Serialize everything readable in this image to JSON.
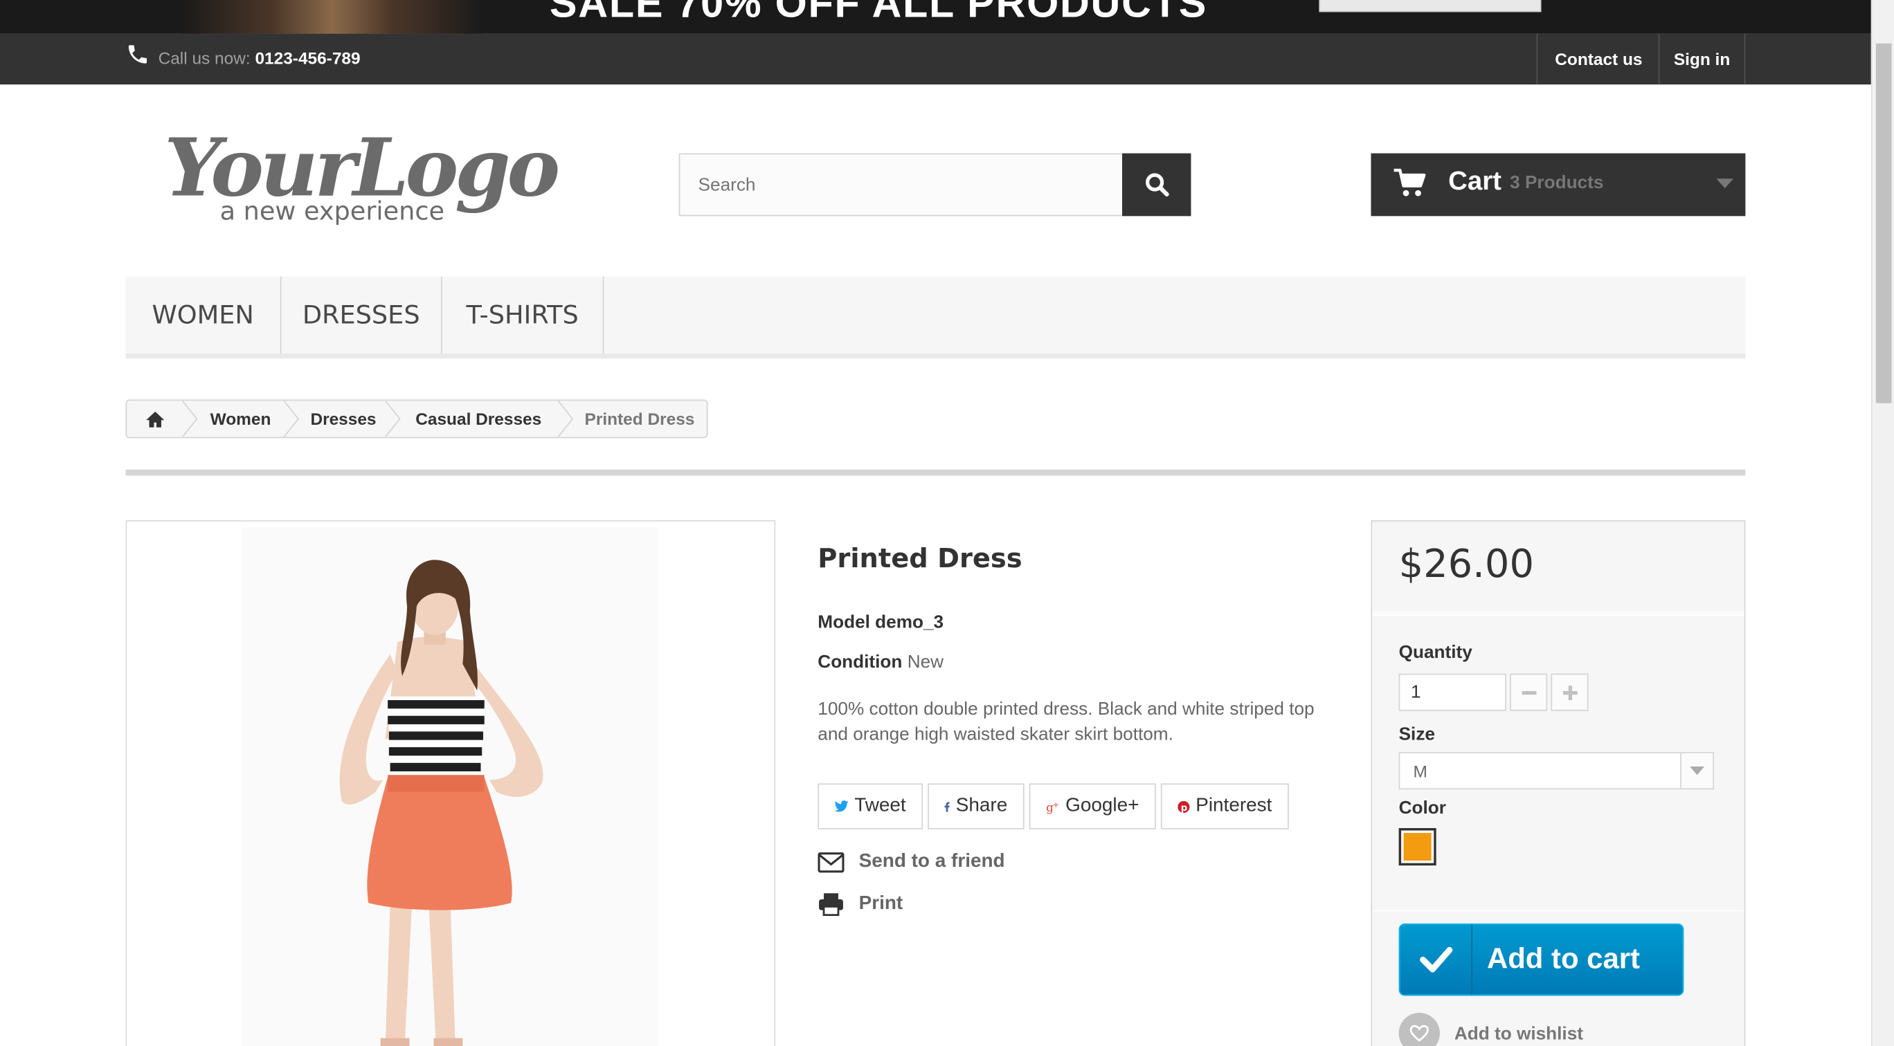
{
  "banner": {
    "text": "SALE 70% OFF ALL PRODUCTS"
  },
  "topbar": {
    "call_label": "Call us now: ",
    "phone": "0123-456-789",
    "contact": "Contact us",
    "signin": "Sign in"
  },
  "logo": {
    "main": "YourLogo",
    "tagline": "a new experience"
  },
  "search": {
    "placeholder": "Search",
    "value": ""
  },
  "cart": {
    "label": "Cart",
    "count": "3 Products"
  },
  "menu": {
    "items": [
      "WOMEN",
      "DRESSES",
      "T-SHIRTS"
    ]
  },
  "breadcrumb": {
    "items": [
      "Women",
      "Dresses",
      "Casual Dresses",
      "Printed Dress"
    ]
  },
  "product": {
    "name": "Printed Dress",
    "model": "Model demo_3",
    "condition_label": "Condition",
    "condition_value": "New",
    "description": "100% cotton double printed dress. Black and white striped top and orange high waisted skater skirt bottom.",
    "social": {
      "tweet": "Tweet",
      "share": "Share",
      "gplus": "Google+",
      "pinterest": "Pinterest"
    },
    "send_to_friend": "Send to a friend",
    "print": "Print"
  },
  "buybox": {
    "price": "$26.00",
    "quantity_label": "Quantity",
    "quantity_value": "1",
    "size_label": "Size",
    "size_value": "M",
    "color_label": "Color",
    "color_value": "#f39c11",
    "add_to_cart": "Add to cart",
    "wishlist": "Add to wishlist"
  },
  "colors": {
    "dark": "#333333",
    "accent": "#009ad0",
    "swatch": "#f39c11"
  }
}
